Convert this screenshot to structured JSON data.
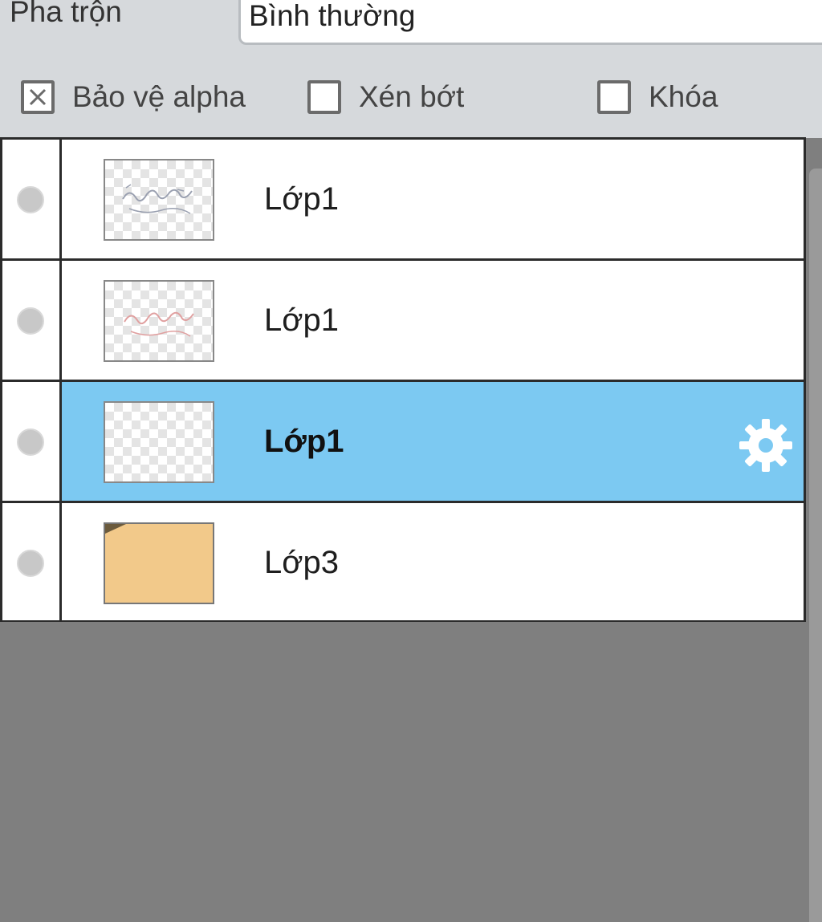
{
  "blend": {
    "label": "Pha trộn",
    "value": "Bình thường"
  },
  "options": [
    {
      "label": "Bảo vệ alpha",
      "checked": true
    },
    {
      "label": "Xén bớt",
      "checked": false
    },
    {
      "label": "Khóa",
      "checked": false
    }
  ],
  "layers": [
    {
      "name": "Lớp1",
      "thumbnail": "transparent-sketch",
      "selected": false
    },
    {
      "name": "Lớp1",
      "thumbnail": "transparent-red-sketch",
      "selected": false
    },
    {
      "name": "Lớp1",
      "thumbnail": "transparent",
      "selected": true,
      "icon": "gear-icon"
    },
    {
      "name": "Lớp3",
      "thumbnail": "orange-fill",
      "selected": false
    }
  ],
  "colors": {
    "selected_row": "#7cc9f2",
    "toolbar_bg": "#d6d9dc",
    "panel_bg": "#7f7f7f",
    "orange_fill": "#f2c98a"
  }
}
